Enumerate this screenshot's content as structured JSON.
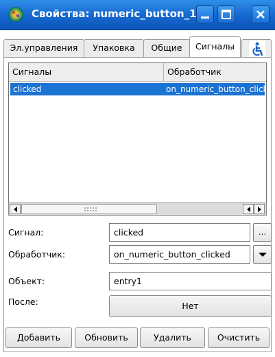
{
  "window": {
    "title": "Свойства: numeric_button_1",
    "accent": "#1b6fd8"
  },
  "tabs": [
    {
      "label": "Эл.управления"
    },
    {
      "label": "Упаковка"
    },
    {
      "label": "Общие"
    },
    {
      "label": "Сигналы"
    },
    {
      "label": "",
      "icon": "accessibility-icon"
    }
  ],
  "signals_table": {
    "columns": [
      "Сигналы",
      "Обработчик"
    ],
    "rows": [
      {
        "signal": "clicked",
        "handler": "on_numeric_button_clicked"
      }
    ],
    "selection_color": "#1b73d3"
  },
  "form": {
    "signal_label": "Сигнал:",
    "signal_value": "clicked",
    "browse_label": "...",
    "handler_label": "Обработчик:",
    "handler_value": "on_numeric_button_clicked",
    "object_label": "Объект:",
    "object_value": "entry1",
    "after_label": "После:",
    "after_value": "Нет"
  },
  "buttons": {
    "add": "Добавить",
    "update": "Обновить",
    "delete": "Удалить",
    "clear": "Очистить"
  }
}
